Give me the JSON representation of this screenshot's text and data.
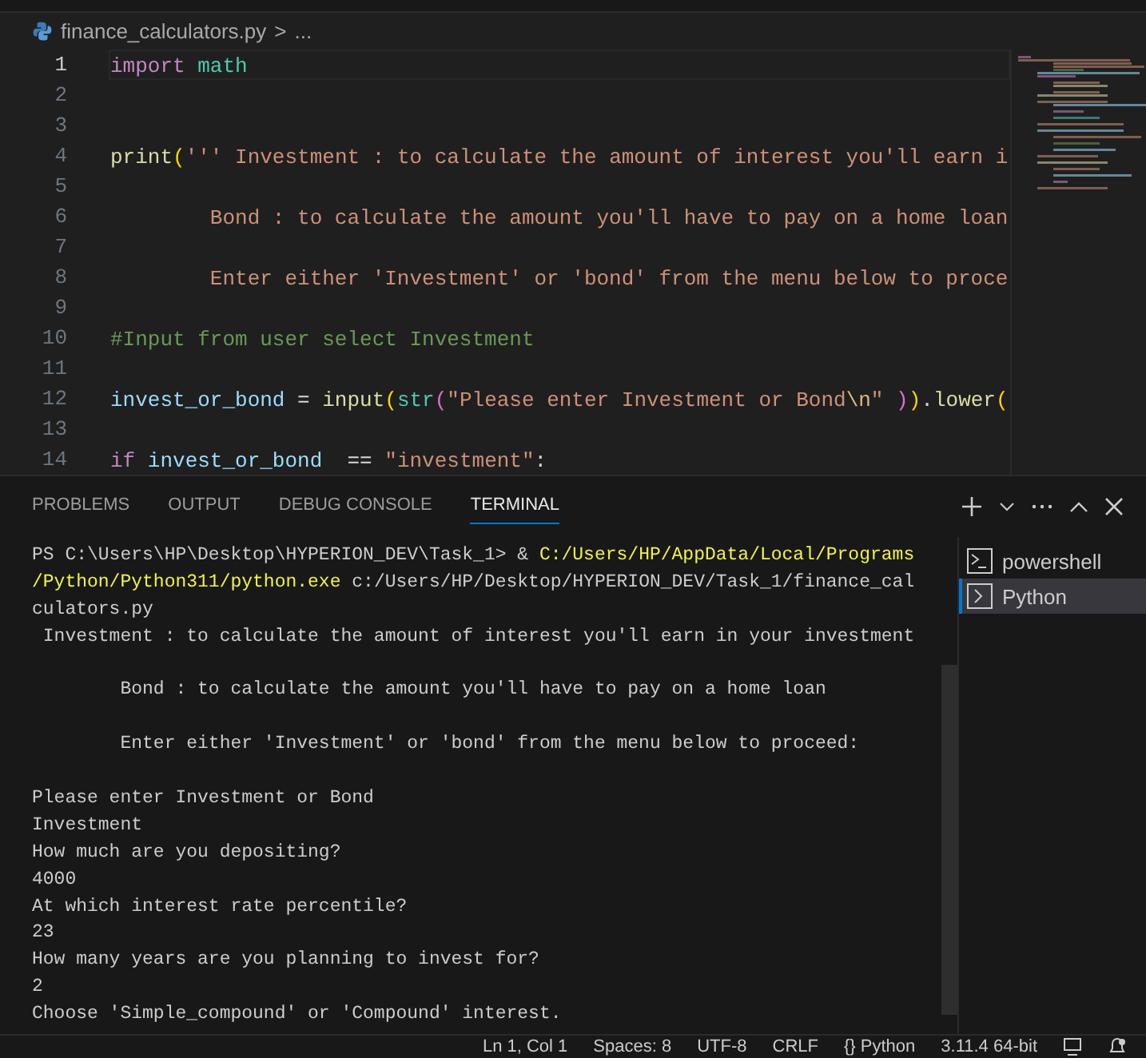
{
  "breadcrumb": {
    "file": "finance_calculators.py",
    "separator": ">",
    "more": "..."
  },
  "editor": {
    "lines": [
      {
        "number": "1",
        "active": true,
        "tokens": [
          {
            "text": "import",
            "kind": "keyword"
          },
          {
            "text": " math",
            "kind": "module"
          }
        ]
      },
      {
        "number": "2",
        "active": false
      },
      {
        "number": "3",
        "active": false
      },
      {
        "number": "4",
        "active": false,
        "tokens": [
          {
            "text": "print",
            "kind": "function"
          },
          {
            "text": "(",
            "kind": "bracket1"
          },
          {
            "text": "''' Investment : to calculate the amount of interest you'll earn i",
            "kind": "string"
          }
        ]
      },
      {
        "number": "5",
        "active": false
      },
      {
        "number": "6",
        "active": false,
        "tokens": [
          {
            "text": "        Bond : to calculate the amount you'll have to pay on a home loan",
            "kind": "string"
          }
        ]
      },
      {
        "number": "7",
        "active": false
      },
      {
        "number": "8",
        "active": false,
        "tokens": [
          {
            "text": "        Enter either 'Investment' or 'bond' from the menu below to proce",
            "kind": "string"
          }
        ]
      },
      {
        "number": "9",
        "active": false
      },
      {
        "number": "10",
        "active": false,
        "tokens": [
          {
            "text": "#Input from user select Investment",
            "kind": "comment"
          }
        ]
      },
      {
        "number": "11",
        "active": false
      },
      {
        "number": "12",
        "active": false,
        "tokens": [
          {
            "text": "invest_or_bond",
            "kind": "variable"
          },
          {
            "text": " = ",
            "kind": "plain"
          },
          {
            "text": "input",
            "kind": "function"
          },
          {
            "text": "(",
            "kind": "bracket1"
          },
          {
            "text": "str",
            "kind": "module"
          },
          {
            "text": "(",
            "kind": "bracket2"
          },
          {
            "text": "\"Please enter Investment or Bond",
            "kind": "string"
          },
          {
            "text": "\\n",
            "kind": "escape"
          },
          {
            "text": "\" ",
            "kind": "string"
          },
          {
            "text": ")",
            "kind": "bracket2"
          },
          {
            "text": ")",
            "kind": "bracket1"
          },
          {
            "text": ".",
            "kind": "plain"
          },
          {
            "text": "lower",
            "kind": "function"
          },
          {
            "text": "(",
            "kind": "bracket1"
          }
        ]
      },
      {
        "number": "13",
        "active": false
      },
      {
        "number": "14",
        "active": false,
        "tokens": [
          {
            "text": "if",
            "kind": "keyword"
          },
          {
            "text": " invest_or_bond",
            "kind": "variable"
          },
          {
            "text": "  == ",
            "kind": "plain"
          },
          {
            "text": "\"investment\"",
            "kind": "string"
          },
          {
            "text": ":",
            "kind": "plain"
          }
        ]
      }
    ]
  },
  "panel": {
    "tabs": [
      {
        "label": "PROBLEMS",
        "selected": false
      },
      {
        "label": "OUTPUT",
        "selected": false
      },
      {
        "label": "DEBUG CONSOLE",
        "selected": false
      },
      {
        "label": "TERMINAL",
        "selected": true
      }
    ],
    "terminal_lines": [
      {
        "blank_before": false,
        "segments": [
          {
            "text": "PS C:\\Users\\HP\\Desktop\\HYPERION_DEV\\Task_1> & ",
            "kind": "plain"
          },
          {
            "text": "C:/Users/HP/AppData/Local/Programs",
            "kind": "path"
          }
        ]
      },
      {
        "blank_before": false,
        "segments": [
          {
            "text": "/Python/Python311/python.exe",
            "kind": "path"
          },
          {
            "text": " c:/Users/HP/Desktop/HYPERION_DEV/Task_1/finance_cal",
            "kind": "plain"
          }
        ]
      },
      {
        "blank_before": false,
        "segments": [
          {
            "text": "culators.py",
            "kind": "plain"
          }
        ]
      },
      {
        "blank_before": false,
        "segments": [
          {
            "text": " Investment : to calculate the amount of interest you'll earn in your investment",
            "kind": "plain"
          }
        ]
      },
      {
        "blank_before": true,
        "segments": [
          {
            "text": "        Bond : to calculate the amount you'll have to pay on a home loan",
            "kind": "plain"
          }
        ]
      },
      {
        "blank_before": true,
        "segments": [
          {
            "text": "        Enter either 'Investment' or 'bond' from the menu below to proceed:",
            "kind": "plain"
          }
        ]
      },
      {
        "blank_before": true,
        "segments": [
          {
            "text": "Please enter Investment or Bond",
            "kind": "plain"
          }
        ]
      },
      {
        "blank_before": false,
        "segments": [
          {
            "text": "Investment",
            "kind": "plain"
          }
        ]
      },
      {
        "blank_before": false,
        "segments": [
          {
            "text": "How much are you depositing?",
            "kind": "plain"
          }
        ]
      },
      {
        "blank_before": false,
        "segments": [
          {
            "text": "4000",
            "kind": "plain"
          }
        ]
      },
      {
        "blank_before": false,
        "segments": [
          {
            "text": "At which interest rate percentile?",
            "kind": "plain"
          }
        ]
      },
      {
        "blank_before": false,
        "segments": [
          {
            "text": "23",
            "kind": "plain"
          }
        ]
      },
      {
        "blank_before": false,
        "segments": [
          {
            "text": "How many years are you planning to invest for?",
            "kind": "plain"
          }
        ]
      },
      {
        "blank_before": false,
        "segments": [
          {
            "text": "2",
            "kind": "plain"
          }
        ]
      },
      {
        "blank_before": false,
        "segments": [
          {
            "text": "Choose 'Simple_compound' or 'Compound' interest.",
            "kind": "plain"
          }
        ]
      }
    ],
    "terminals": [
      {
        "name": "powershell",
        "selected": false
      },
      {
        "name": "Python",
        "selected": true
      }
    ]
  },
  "status_bar": {
    "items": [
      "Ln 1, Col 1",
      "Spaces: 8",
      "UTF-8",
      "CRLF"
    ],
    "language_icon": "{}",
    "language": "Python",
    "interpreter": "3.11.4 64-bit"
  }
}
